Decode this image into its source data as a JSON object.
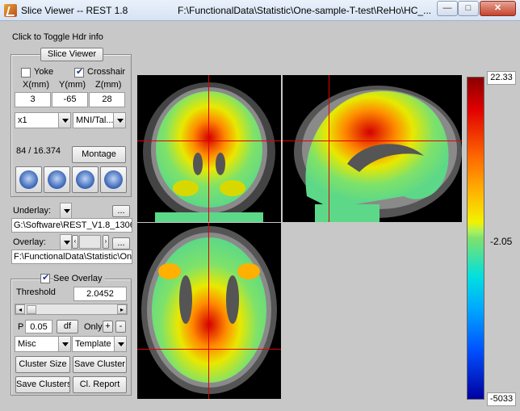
{
  "window": {
    "title": "Slice Viewer -- REST 1.8",
    "path": "F:\\FunctionalData\\Statistic\\One-sample-T-test\\ReHo\\HC_...",
    "minimize_label": "—",
    "maximize_label": "□",
    "close_label": "✕"
  },
  "hdr_toggle": "Click to Toggle Hdr info",
  "viewer_panel": {
    "title": "Slice Viewer",
    "yoke_label": "Yoke",
    "yoke_checked": false,
    "crosshair_label": "Crosshair",
    "crosshair_checked": true,
    "x_label": "X(mm)",
    "y_label": "Y(mm)",
    "z_label": "Z(mm)",
    "x_value": "3",
    "y_value": "-65",
    "z_value": "28",
    "zoom_value": "x1",
    "space_value": "MNI/Tal...",
    "intensity_readout": "84 / 16.374",
    "montage_label": "Montage",
    "view_icons": [
      "axial-view-icon",
      "sagittal-view-icon",
      "coronal-view-icon",
      "ortho-view-icon"
    ]
  },
  "underlay": {
    "label": "Underlay:",
    "browse_label": "...",
    "path": "G:\\Software\\REST_V1.8_1306"
  },
  "overlay": {
    "label": "Overlay:",
    "browse_label": "...",
    "path": "F:\\FunctionalData\\Statistic\\One"
  },
  "overlay_panel": {
    "see_overlay_label": "See Overlay",
    "see_overlay_checked": true,
    "threshold_label": "Threshold",
    "threshold_value": "2.0452",
    "p_label": "P",
    "p_value": "0.05",
    "df_label": "df",
    "only_label": "Only",
    "plus_label": "+",
    "minus_label": "-",
    "misc_value": "Misc",
    "template_value": "Template",
    "cluster_size_label": "Cluster Size",
    "save_cluster_label": "Save Cluster",
    "save_clusters_label": "Save Clusters",
    "cl_report_label": "Cl. Report"
  },
  "colorbar": {
    "max_label": "22.33",
    "mid_label": "-2.05",
    "min_label": "-5033"
  }
}
